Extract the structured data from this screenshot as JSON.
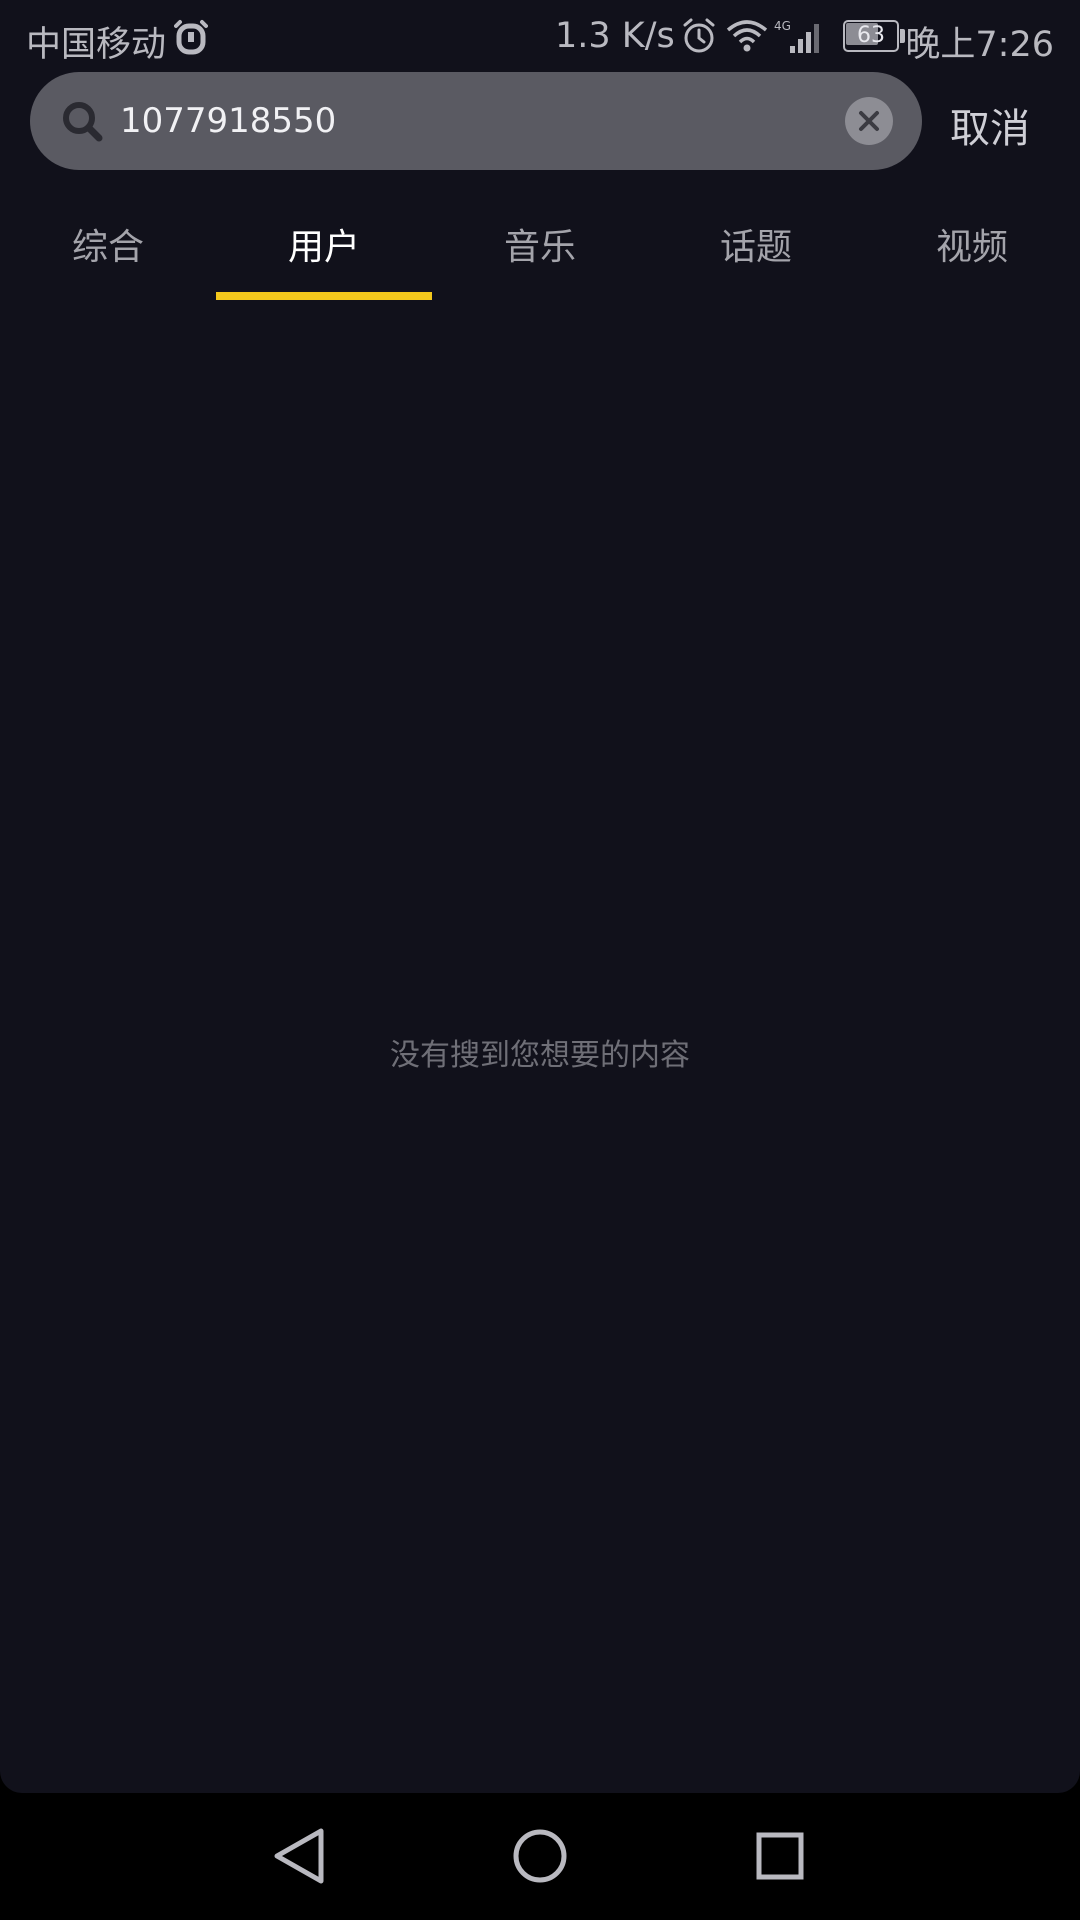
{
  "status_bar": {
    "carrier": "中国移动",
    "net_speed": "1.3 K/s",
    "network_type": "4G",
    "battery_level": "63",
    "time": "晚上7:26",
    "icons": [
      "alarm-app-icon",
      "alarm-icon",
      "wifi-icon",
      "signal-icon",
      "battery-icon"
    ]
  },
  "search": {
    "value": "1077918550",
    "cancel_label": "取消"
  },
  "tabs": [
    {
      "label": "综合",
      "active": false
    },
    {
      "label": "用户",
      "active": true
    },
    {
      "label": "音乐",
      "active": false
    },
    {
      "label": "话题",
      "active": false
    },
    {
      "label": "视频",
      "active": false
    }
  ],
  "empty_state": {
    "message": "没有搜到您想要的内容"
  },
  "colors": {
    "background": "#11111b",
    "accent": "#f3c81c",
    "search_box": "#5a5a62"
  },
  "nav_bar": {
    "icons": [
      "back-icon",
      "home-icon",
      "recents-icon"
    ]
  }
}
